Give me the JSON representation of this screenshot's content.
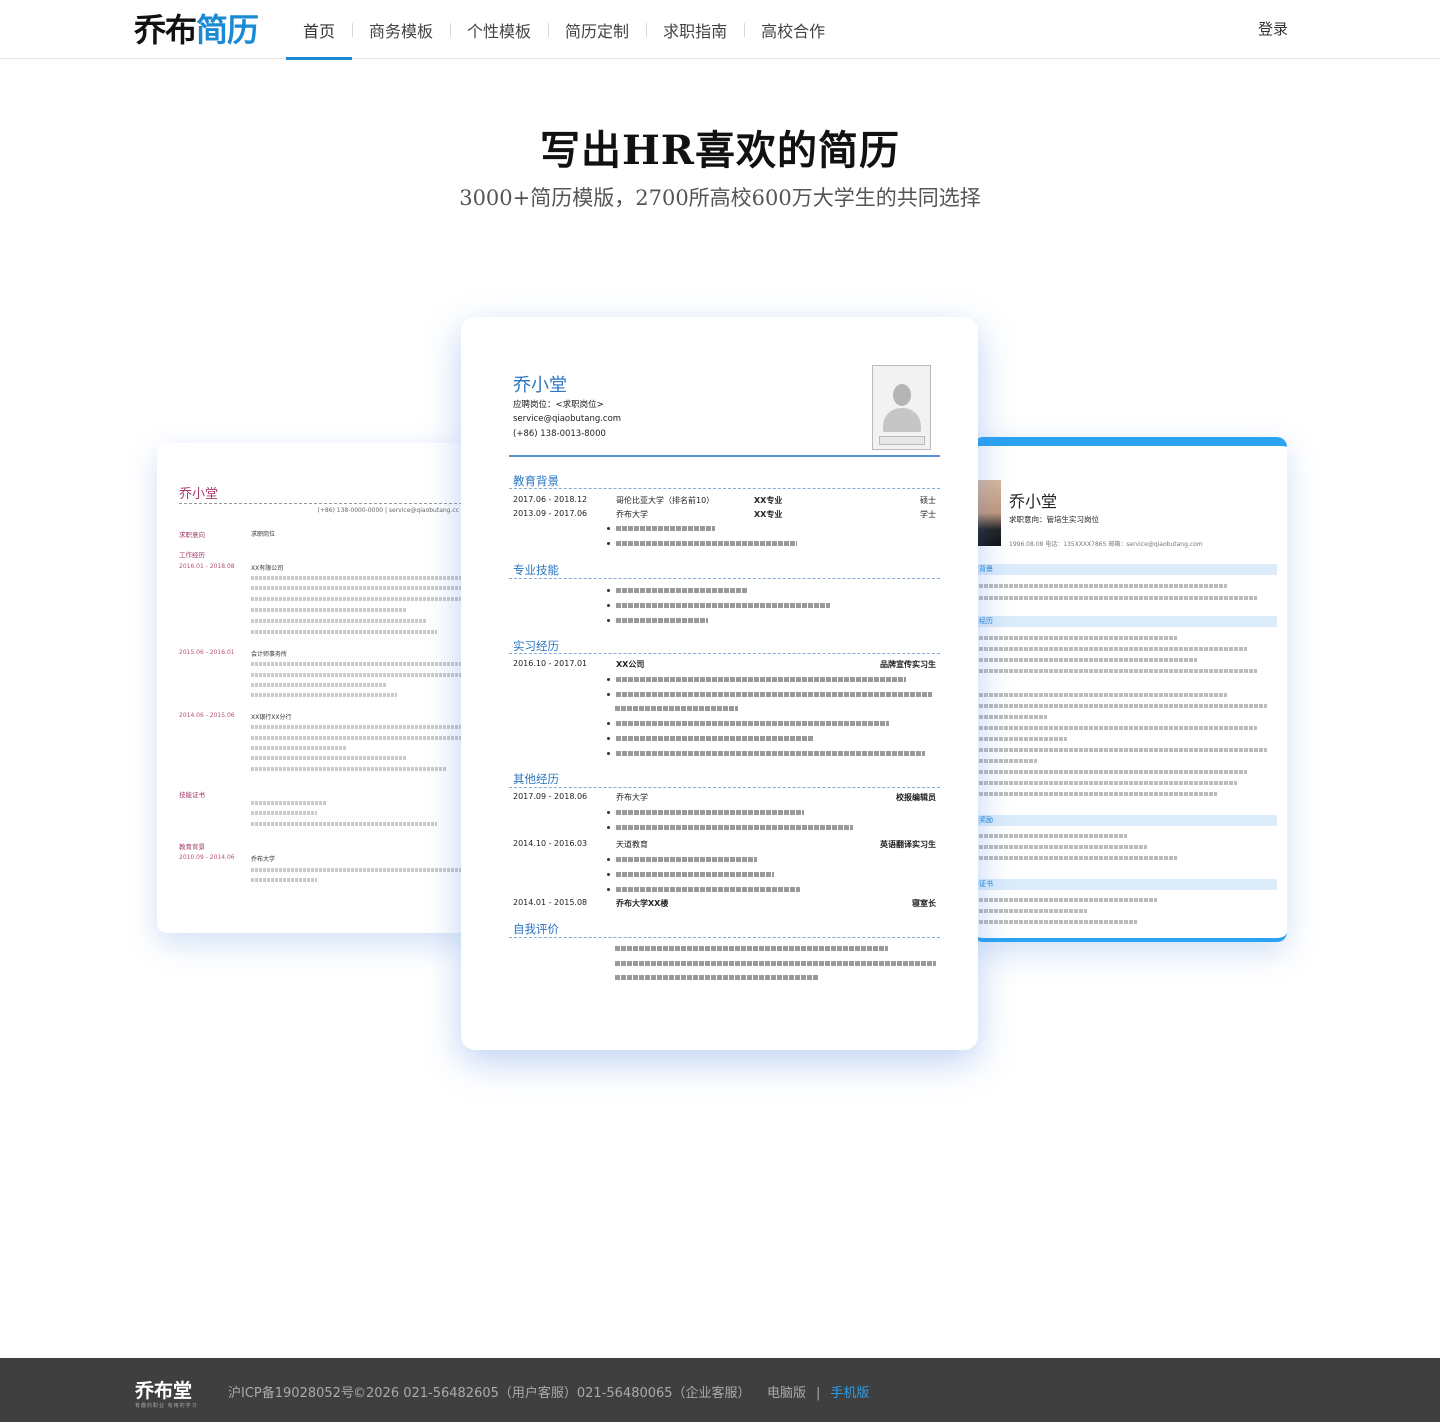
{
  "header": {
    "logo_part1": "乔布",
    "logo_part2": "简历",
    "nav": [
      "首页",
      "商务模板",
      "个性模板",
      "简历定制",
      "求职指南",
      "高校合作"
    ],
    "login": "登录"
  },
  "hero": {
    "title": "写出HR喜欢的简历",
    "subtitle": "3000+简历模版，2700所高校600万大学生的共同选择"
  },
  "resume_left": {
    "name": "乔小堂",
    "contact": "(+86) 138-0000-0000  |  service@qiaobutang.cc",
    "labels": [
      "求职意向",
      "工作经历",
      "技能证书",
      "教育背景"
    ],
    "intention": "求职岗位",
    "dates": [
      "2016.01 - 2018.08",
      "2015.06 - 2016.01",
      "2014.06 - 2015.06",
      "2010.09 - 2014.06"
    ],
    "orgs": [
      "XX有限公司",
      "会计师事务所",
      "XX银行XX分行",
      "乔布大学"
    ]
  },
  "resume_center": {
    "name": "乔小堂",
    "position": "应聘岗位：<求职岗位>",
    "email": "service@qiaobutang.com",
    "phone": "(+86) 138-0013-8000",
    "sections": [
      "教育背景",
      "专业技能",
      "实习经历",
      "其他经历",
      "自我评价"
    ],
    "education": [
      {
        "date": "2017.06 - 2018.12",
        "org": "哥伦比亚大学（排名前10）",
        "major": "XX专业",
        "degree": "硕士"
      },
      {
        "date": "2013.09 - 2017.06",
        "org": "乔布大学",
        "major": "XX专业",
        "degree": "学士"
      }
    ],
    "internship": {
      "date": "2016.10 - 2017.01",
      "org": "XX公司",
      "role": "品牌宣传实习生"
    },
    "other": [
      {
        "date": "2017.09 - 2018.06",
        "org": "乔布大学",
        "role": "校报编辑员"
      },
      {
        "date": "2014.10 - 2016.03",
        "org": "天道教育",
        "role": "英语翻译实习生"
      },
      {
        "date": "2014.01 - 2015.08",
        "org": "乔布大学XX楼",
        "role": "寝室长"
      }
    ]
  },
  "resume_right": {
    "name": "乔小堂",
    "intention": "求职意向：管培生实习岗位",
    "contact": "1996.08.08     电话：135XXXX7865     邮箱：service@qiaobutang.com",
    "sections": [
      "背景",
      "经历",
      "奖励",
      "证书"
    ]
  },
  "footer": {
    "logo": "乔布堂",
    "logo_sub": "有趣的职业  有用的学习",
    "icp": "沪ICP备19028052号",
    "copyright": "©2026  021-56482605（用户客服）021-56480065（企业客服）",
    "pc": "电脑版",
    "separator": "|",
    "mobile": "手机版"
  },
  "colors": {
    "brand_blue": "#1a8ad4",
    "resume_blue": "#2a75c4",
    "resume_pink": "#a33a6a",
    "footer_bg": "#3f3f3f"
  }
}
